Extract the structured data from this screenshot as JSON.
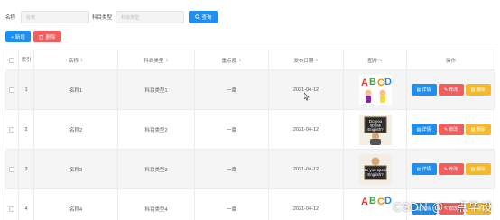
{
  "search": {
    "name_label": "名称",
    "name_placeholder": "名称",
    "type_label": "科目类型",
    "type_placeholder": "科目类型",
    "query_label": "查询"
  },
  "actions": {
    "add_label": "+ 新增",
    "delete_label": "删除"
  },
  "table": {
    "headers": {
      "index": "索引",
      "name": "名称",
      "type": "科目类型",
      "state": "重点度",
      "date": "发布日期",
      "picture": "图片",
      "ops": "操作"
    },
    "rows": [
      {
        "index": "1",
        "name": "名称1",
        "type": "科目类型1",
        "state": "一章",
        "date": "2021-04-12",
        "picture": "abcd-kids"
      },
      {
        "index": "2",
        "name": "名称2",
        "type": "科目类型2",
        "state": "一章",
        "date": "2021-04-12",
        "picture": "speak-english-sign"
      },
      {
        "index": "3",
        "name": "名称3",
        "type": "科目类型3",
        "state": "一章",
        "date": "2021-04-12",
        "picture": "speak-english-sign"
      },
      {
        "index": "4",
        "name": "名称4",
        "type": "科目类型4",
        "state": "一章",
        "date": "2021-04-12",
        "picture": "abcd-kids"
      }
    ],
    "row_actions": {
      "detail": "详情",
      "edit": "修改",
      "remove": "删除"
    }
  },
  "watermark": "CSDN @一点毕设",
  "colors": {
    "primary": "#1e8eef",
    "danger": "#f05e5e",
    "warning": "#f5b92d"
  }
}
